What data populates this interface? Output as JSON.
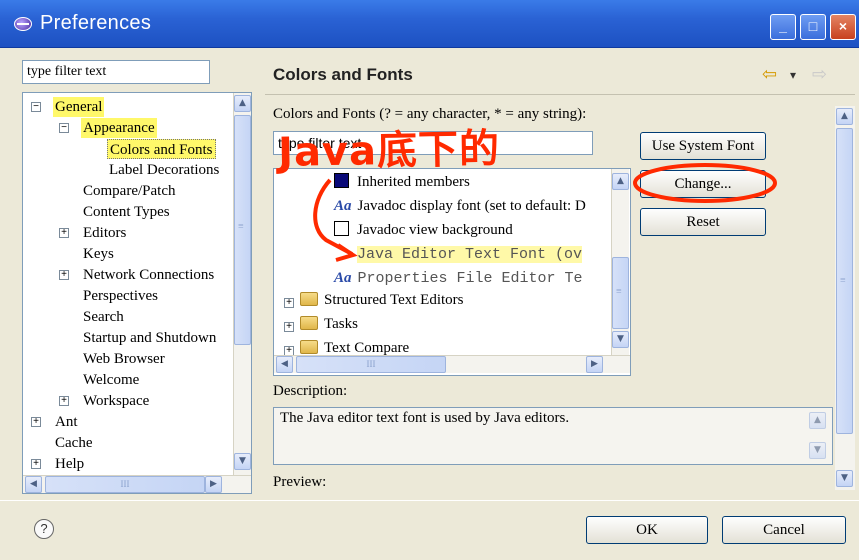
{
  "window": {
    "title": "Preferences"
  },
  "filter": {
    "value": "type filter text"
  },
  "tree": {
    "items": [
      {
        "label": "General",
        "expander": "−",
        "highlighted": true
      },
      {
        "label": "Appearance",
        "expander": "−",
        "highlighted": true
      },
      {
        "label": "Colors and Fonts",
        "selected": true
      },
      {
        "label": "Label Decorations"
      },
      {
        "label": "Compare/Patch"
      },
      {
        "label": "Content Types"
      },
      {
        "label": "Editors",
        "expander": "+"
      },
      {
        "label": "Keys"
      },
      {
        "label": "Network Connections",
        "expander": "+"
      },
      {
        "label": "Perspectives"
      },
      {
        "label": "Search"
      },
      {
        "label": "Startup and Shutdown"
      },
      {
        "label": "Web Browser"
      },
      {
        "label": "Welcome"
      },
      {
        "label": "Workspace",
        "expander": "+"
      },
      {
        "label": "Ant",
        "expander": "+"
      },
      {
        "label": "Cache"
      },
      {
        "label": "Help",
        "expander": "+"
      }
    ],
    "hscroll_glyph": "III",
    "vscroll_glyph": "≡"
  },
  "page": {
    "title": "Colors and Fonts",
    "nav_back": "⇦",
    "nav_dropdown": "▾",
    "nav_forward": "⇨",
    "fonts_label": "Colors and Fonts (? = any character, * = any string):",
    "fonts_filter_value": "type filter text",
    "fonts_items": [
      {
        "icon": "color-swatch",
        "swatch": "#0a0a78",
        "label": "Inherited members"
      },
      {
        "icon": "font",
        "icon_text": "Aa",
        "label": "Javadoc display font (set to default: D"
      },
      {
        "icon": "color-swatch",
        "swatch": "#ffffff",
        "label": "Javadoc view background"
      },
      {
        "icon": "none",
        "label": "Java Editor Text Font (ov",
        "mono": true,
        "highlighted": true
      },
      {
        "icon": "font",
        "icon_text": "Aa",
        "label": "Properties File Editor Te",
        "mono": true
      },
      {
        "icon": "folder",
        "expander": "+",
        "label": "Structured Text Editors"
      },
      {
        "icon": "folder",
        "expander": "+",
        "label": "Tasks"
      },
      {
        "icon": "folder",
        "expander": "+",
        "label": "Text Compare"
      }
    ],
    "buttons": {
      "use_system_font": "Use System Font",
      "change": "Change...",
      "reset": "Reset"
    },
    "description_label": "Description:",
    "description_text": "The Java editor text font is used by Java editors.",
    "preview_label": "Preview:"
  },
  "annotation": {
    "text": "Java底下的",
    "color": "#ff2a00"
  },
  "footer": {
    "help": "?",
    "ok": "OK",
    "cancel": "Cancel"
  }
}
